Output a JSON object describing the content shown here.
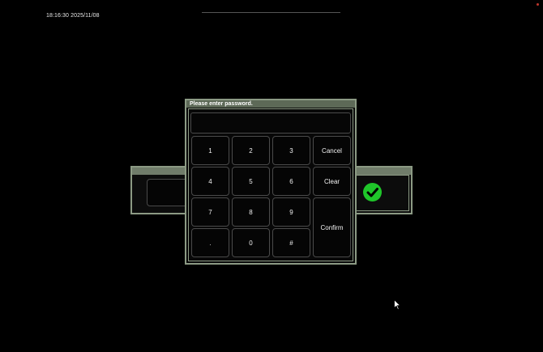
{
  "status_bar": {
    "clock": "18:16:30 2025/11/08"
  },
  "dialog": {
    "title": "Please enter password.",
    "password_value": "",
    "keys": {
      "k1": "1",
      "k2": "2",
      "k3": "3",
      "k4": "4",
      "k5": "5",
      "k6": "6",
      "k7": "7",
      "k8": "8",
      "k9": "9",
      "kdot": ".",
      "k0": "0",
      "khash": "#",
      "cancel": "Cancel",
      "clear": "Clear",
      "confirm": "Confirm"
    }
  },
  "icons": {
    "confirm_check": "check-circle-icon",
    "pointer": "mouse-pointer-icon"
  },
  "colors": {
    "background": "#000000",
    "frame_border": "#8c9a84",
    "title_bar": "#5d6957",
    "check_green": "#1fc62a",
    "key_border": "#4a4a4a"
  }
}
